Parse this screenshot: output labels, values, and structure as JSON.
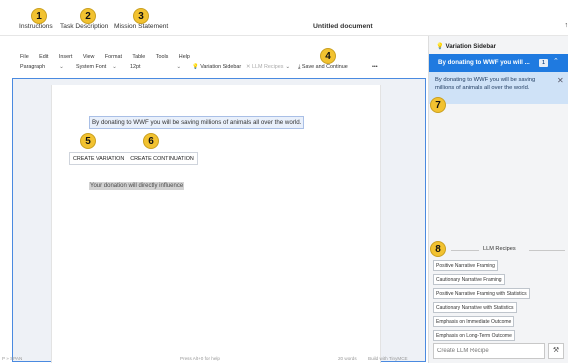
{
  "tabs": {
    "instructions": "Instructions",
    "task_description": "Task Description",
    "mission_statement": "Mission Statement"
  },
  "document": {
    "title": "Untitled document"
  },
  "menubar": [
    "File",
    "Edit",
    "Insert",
    "View",
    "Format",
    "Table",
    "Tools",
    "Help"
  ],
  "toolbar": {
    "paragraph": "Paragraph",
    "font": "System Font",
    "size": "12pt",
    "variation_sidebar": "Variation Sidebar",
    "llm_recipes": "LLM Recipes",
    "save_continue": "Save and Continue",
    "more": "•••"
  },
  "editor": {
    "sentence": "By donating to WWF you will be saving millions of animals all over the world.",
    "create_variation": "CREATE VARIATION",
    "create_continuation": "CREATE CONTINUATION",
    "continuation_text": "Your donation will directly influence"
  },
  "statusbar": {
    "left": "P » SPAN",
    "center": "Press Alt+0 for help",
    "words": "20 words",
    "built": "Build with TinyMCE"
  },
  "sidebar": {
    "title": "Variation Sidebar",
    "header_text": "By donating to WWF you will ...",
    "badge": "1",
    "body_text": "By donating to WWF you will be saving millions of animals all over the world.",
    "recipes_label": "LLM Recipes",
    "recipes": [
      "Positive Narrative Framing",
      "Cautionary Narrative Framing",
      "Positive Narrative Framing with Statistics",
      "Cautionary Narrative with Statistics",
      "Emphasis on Immediate Outcome",
      "Emphasis on Long-Term Outcome"
    ],
    "create_placeholder": "Create LLM Recipe"
  },
  "markers": [
    "1",
    "2",
    "3",
    "4",
    "5",
    "6",
    "7",
    "8"
  ],
  "colors": {
    "accent": "#1f7ae0",
    "marker": "#f2c230",
    "sidebar_body": "#cfe2f7"
  }
}
